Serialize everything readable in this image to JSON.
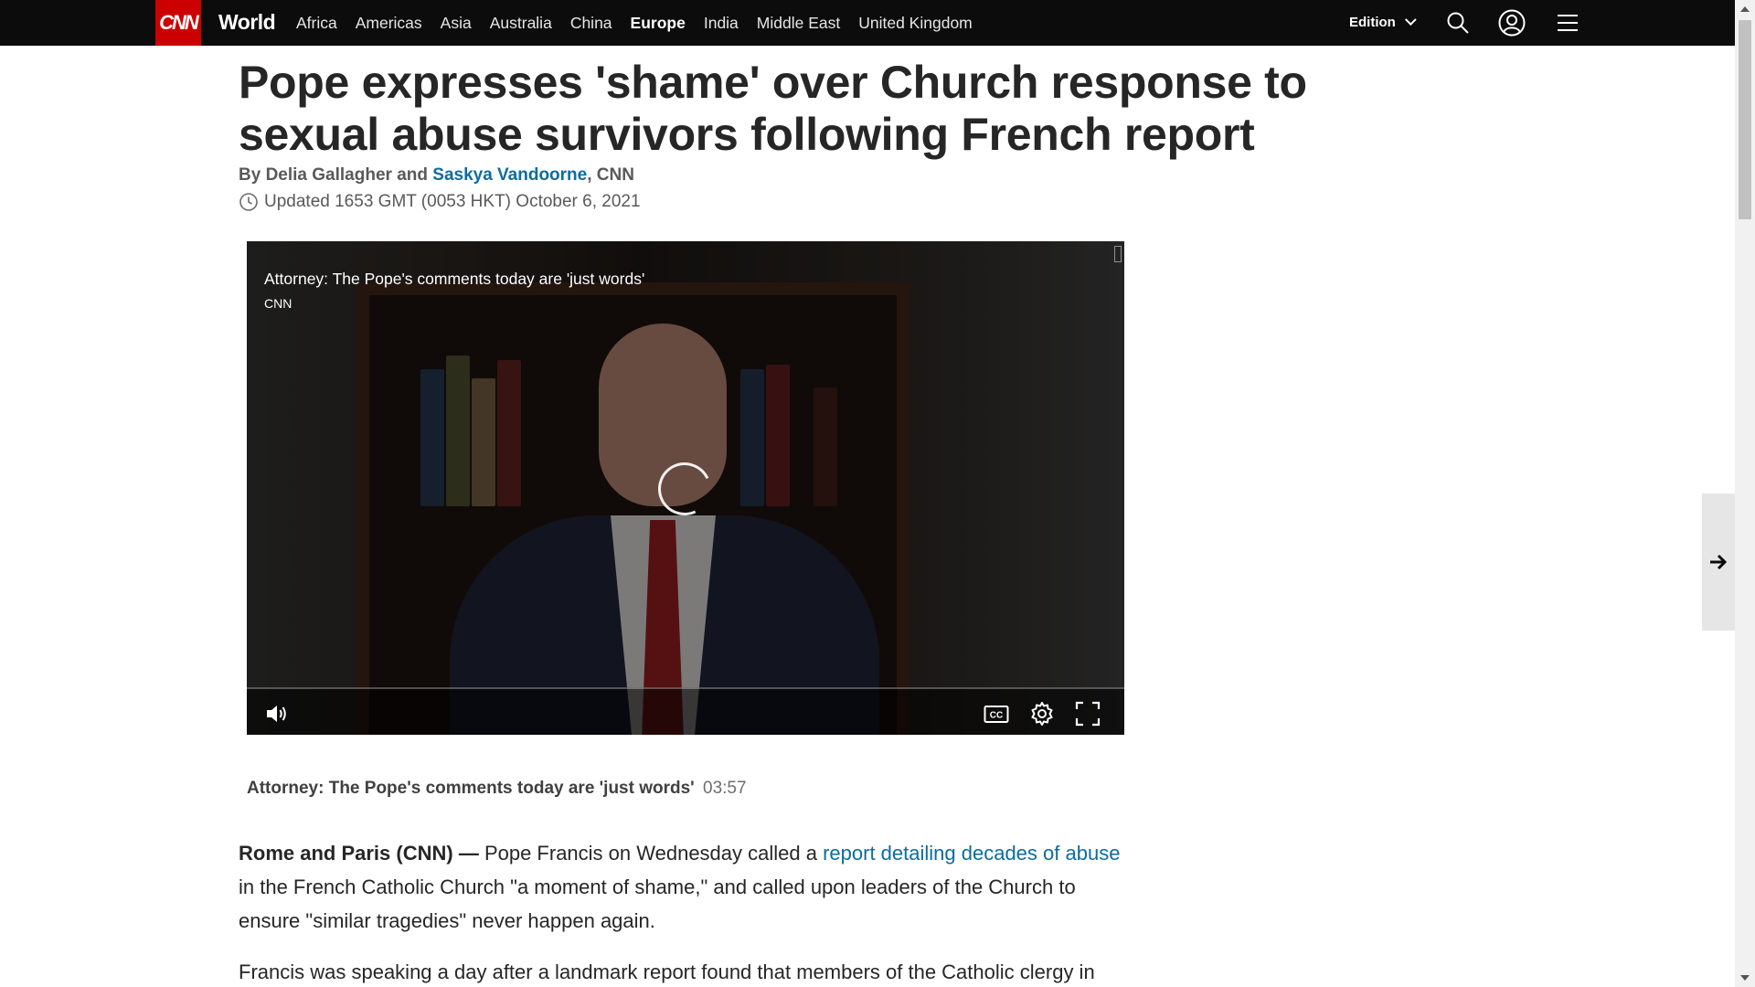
{
  "nav": {
    "logo": "CNN",
    "section": "World",
    "links": [
      "Africa",
      "Americas",
      "Asia",
      "Australia",
      "China",
      "Europe",
      "India",
      "Middle East",
      "United Kingdom"
    ],
    "active_link": "Europe",
    "edition_label": "Edition"
  },
  "article": {
    "headline": "Pope expresses 'shame' over Church response to sexual abuse survivors following French report",
    "byline": {
      "prefix": "By ",
      "author1": "Delia Gallagher",
      "conj": " and ",
      "author2": "Saskya Vandoorne",
      "suffix": ", CNN"
    },
    "timestamp": "Updated 1653 GMT (0053 HKT) October 6, 2021",
    "video": {
      "title": "Attorney: The Pope's comments today are 'just words'",
      "source": "CNN"
    },
    "caption": {
      "title": "Attorney: The Pope's comments today are 'just words'",
      "duration": "03:57"
    },
    "para1": {
      "dateline": "Rome and Paris (CNN) — ",
      "text_a": "Pope Francis on Wednesday called a ",
      "link": "report detailing decades of abuse",
      "text_b": " in the French Catholic Church \"a moment of shame,\" and called upon leaders of the Church to ensure \"similar tragedies\" never happen again."
    },
    "para2": "Francis was speaking a day after a landmark report found that members of the Catholic clergy in"
  },
  "colors": {
    "nav_bg": "#0c0c0c",
    "brand_red": "#cc0000",
    "link_blue": "#0c6c9f"
  }
}
